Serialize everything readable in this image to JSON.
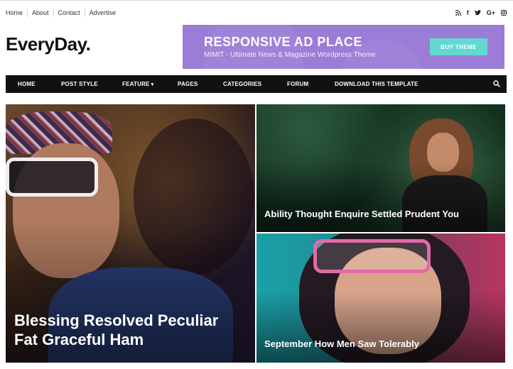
{
  "topbar": {
    "links": [
      "Home",
      "About",
      "Contact",
      "Advertise"
    ],
    "social_icons": [
      "rss-icon",
      "facebook-icon",
      "twitter-icon",
      "google-plus-icon",
      "instagram-icon"
    ],
    "social_glyphs": [
      "≡",
      "f",
      "•",
      "G+",
      "▣"
    ]
  },
  "header": {
    "logo": "EveryDay.",
    "ad": {
      "title": "RESPONSIVE AD PLACE",
      "subtitle": "MIMIT - Ultimate News & Magazine Wordpress Theme",
      "button": "BUY THEME",
      "bg_color": "#9b7cd6",
      "button_color": "#64d8d0"
    }
  },
  "nav": {
    "items": [
      "HOME",
      "POST STYLE",
      "FEATURE",
      "PAGES",
      "CATEGORIES",
      "FORUM",
      "DOWNLOAD THIS TEMPLATE"
    ],
    "search_icon": "search-icon"
  },
  "posts": [
    {
      "title": "Blessing Resolved Peculiar Fat Graceful Ham"
    },
    {
      "title": "Ability Thought Enquire Settled Prudent You"
    },
    {
      "title": "September How Men Saw Tolerably"
    }
  ]
}
